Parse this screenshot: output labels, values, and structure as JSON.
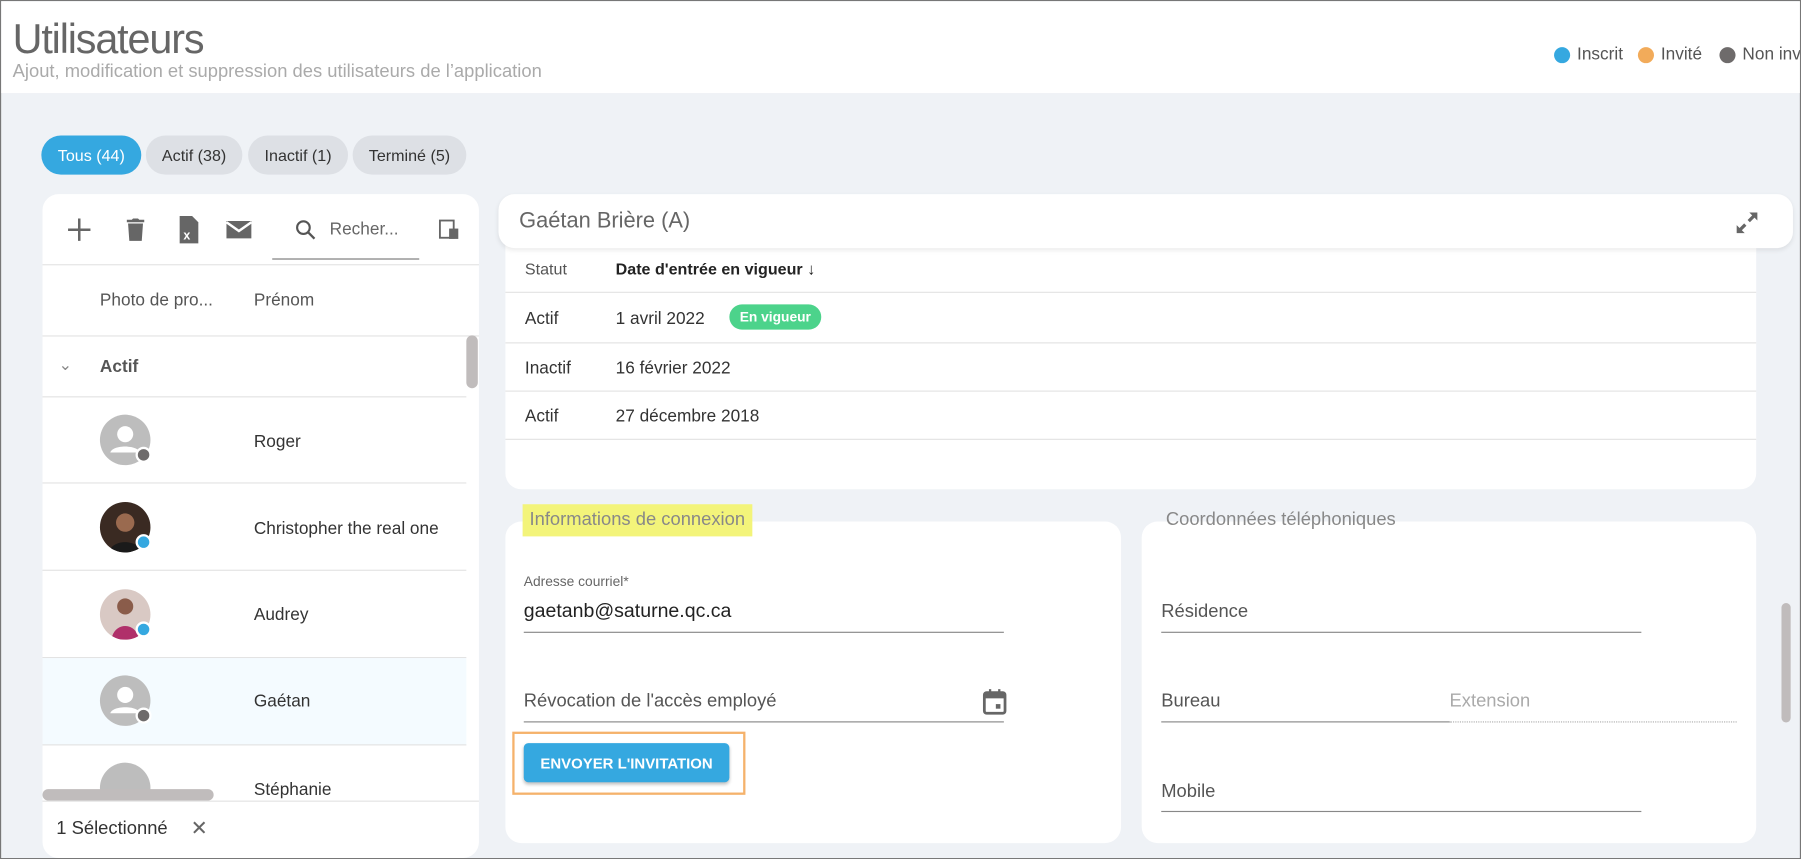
{
  "header": {
    "title": "Utilisateurs",
    "subtitle": "Ajout, modification et suppression des utilisateurs de l’application",
    "legend": [
      {
        "label": "Inscrit",
        "color": "#35a8e0"
      },
      {
        "label": "Invité",
        "color": "#f2ab5a"
      },
      {
        "label": "Non invité",
        "color": "#6e6b6b"
      }
    ]
  },
  "tabs": [
    {
      "label": "Tous (44)",
      "active": true
    },
    {
      "label": "Actif (38)"
    },
    {
      "label": "Inactif (1)"
    },
    {
      "label": "Terminé (5)"
    }
  ],
  "toolbar": {
    "icons": [
      "plus-icon",
      "trash-icon",
      "excel-icon",
      "mail-icon"
    ],
    "search_placeholder": "Recher...",
    "columns_icon": "column-chooser-icon"
  },
  "list": {
    "columns": [
      "Photo de pro...",
      "Prénom"
    ],
    "group": "Actif",
    "rows": [
      {
        "name": "Roger",
        "status": "Non invité",
        "photo": false
      },
      {
        "name": "Christopher the real one",
        "status": "Inscrit",
        "photo": true
      },
      {
        "name": "Audrey",
        "status": "Inscrit",
        "photo": true
      },
      {
        "name": "Gaétan",
        "status": "Non invité",
        "photo": false,
        "selected": true
      },
      {
        "name": "Stéphanie",
        "photo": false
      }
    ],
    "footer": "1 Sélectionné"
  },
  "detail": {
    "title": "Gaétan Brière (A)",
    "history": {
      "columns": [
        "Statut",
        "Date d'entrée en vigueur ↓"
      ],
      "rows": [
        {
          "status": "Actif",
          "date": "1 avril 2022",
          "badge": "En vigueur"
        },
        {
          "status": "Inactif",
          "date": "16 février 2022"
        },
        {
          "status": "Actif",
          "date": "27 décembre 2018"
        }
      ]
    },
    "connexion": {
      "title": "Informations de connexion",
      "email_label": "Adresse courriel*",
      "email": "gaetanb@saturne.qc.ca",
      "revocation_label": "Révocation de l'accès employé",
      "invite_button": "ENVOYER L'INVITATION"
    },
    "phones": {
      "title": "Coordonnées téléphoniques",
      "residence": "Résidence",
      "bureau": "Bureau",
      "extension": "Extension",
      "mobile": "Mobile"
    }
  },
  "colors": {
    "accent": "#35a8e0",
    "success": "#4cd38b",
    "highlight": "#f3f47a",
    "invite_outline": "#f5b26b"
  }
}
